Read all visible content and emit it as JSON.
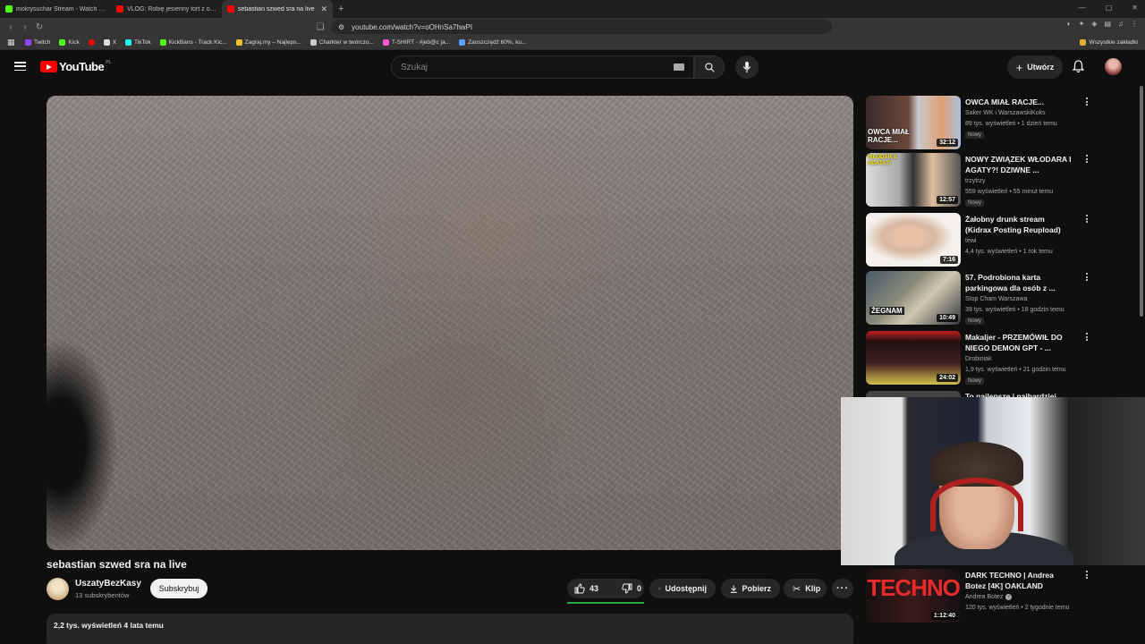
{
  "browser": {
    "tabs": [
      {
        "title": "mokrysuchar Stream - Watch Live on",
        "color": "#53fc18",
        "active": false
      },
      {
        "title": "VLOG: Robię jesienny tort z okazji im",
        "color": "#ff0000",
        "active": false
      },
      {
        "title": "sebastian szwed sra na live",
        "color": "#ff0000",
        "active": true
      }
    ],
    "url": "youtube.com/watch?v=oOHnSa7hwPI",
    "bookmarks": [
      {
        "label": "Twitch",
        "color": "#9146ff"
      },
      {
        "label": "Kick",
        "color": "#53fc18"
      },
      {
        "label": "",
        "color": "#ff0000"
      },
      {
        "label": "X",
        "color": "#ffffff"
      },
      {
        "label": "TikTok",
        "color": "#25f4ee"
      },
      {
        "label": "KickBans - Track Kic...",
        "color": "#53fc18"
      },
      {
        "label": "Zagraj.my – Najleps...",
        "color": "#f2c12e"
      },
      {
        "label": "Charkter w twórczo...",
        "color": "#cccccc"
      },
      {
        "label": "T-SHIRT - #jeb@c ja...",
        "color": "#ff5ad2"
      },
      {
        "label": "Zaoszczędź 60%, ku...",
        "color": "#5aa0ff"
      }
    ],
    "all_bookmarks": "Wszystkie zakładki"
  },
  "header": {
    "logo": "YouTube",
    "country": "PL",
    "search_placeholder": "Szukaj",
    "create_label": "Utwórz"
  },
  "video": {
    "title": "sebastian szwed sra na live",
    "channel": "UszatyBezKasy",
    "subscribers": "13 subskrybentów",
    "subscribe_label": "Subskrybuj",
    "likes": "43",
    "dislikes": "0",
    "like_ratio": 1.0,
    "share_label": "Udostępnij",
    "download_label": "Pobierz",
    "clip_label": "Klip",
    "description_meta": "2,2 tys. wyświetleń  4 lata temu"
  },
  "recommendations": [
    {
      "title": "OWCA MIAŁ RACJE...",
      "channel": "Saker WK i WarszawskiKoks",
      "meta": "89 tys. wyświetleń • 1 dzień temu",
      "badge": "Nowy",
      "duration": "32:12",
      "thumb_text": "OWCA MIAŁ RACJE..."
    },
    {
      "title": "NOWY ZWIĄZEK WŁODARA I AGATY?! DZIWNE ...",
      "channel": "trzytrzy",
      "meta": "559 wyświetleń • 55 minut temu",
      "badge": "Nowy",
      "duration": "12:57",
      "thumb_text": "WŁODAR & AGATA?!"
    },
    {
      "title": "Żałobny drunk stream (Kidrax Posting Reupload)",
      "channel": "tewi",
      "meta": "4,4 tys. wyświetleń • 1 rok temu",
      "badge": "",
      "duration": "7:16",
      "thumb_text": ""
    },
    {
      "title": "57. Podrobiona karta parkingowa dla osób z ...",
      "channel": "Stop Cham Warszawa",
      "meta": "39 tys. wyświetleń • 18 godzin temu",
      "badge": "Nowy",
      "duration": "10:49",
      "thumb_text": "ŻEGNAM"
    },
    {
      "title": "Makaljer - PRZEMÓWIŁ DO NIEGO DEMON GPT - ...",
      "channel": "Drobiniak",
      "meta": "1,9 tys. wyświetleń • 21 godzin temu",
      "badge": "Nowy",
      "duration": "24:02",
      "thumb_text": ""
    },
    {
      "title": "DARK TECHNO | Andrea Botez [4K] OAKLAND",
      "channel": "Andrea Botez",
      "meta": "120 tys. wyświetleń • 2 tygodnie temu",
      "badge": "",
      "duration": "1:12:40",
      "thumb_text": "TECHNO"
    }
  ],
  "partial_rec_title": "To najlepsze i najbardziej..."
}
